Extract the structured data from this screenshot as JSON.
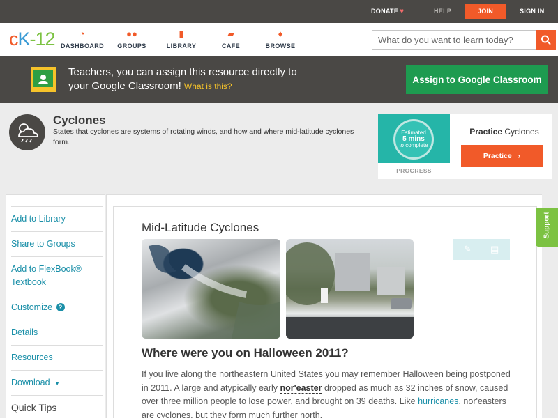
{
  "topbar": {
    "donate": "DONATE",
    "help": "HELP",
    "join": "JOIN",
    "signin": "SIGN IN"
  },
  "nav": {
    "logo": {
      "c": "c",
      "k": "K",
      "dash": "-",
      "n": "12"
    },
    "items": [
      {
        "label": "DASHBOARD",
        "icon": "dashboard-icon"
      },
      {
        "label": "GROUPS",
        "icon": "groups-icon"
      },
      {
        "label": "LIBRARY",
        "icon": "library-icon"
      },
      {
        "label": "CAFE",
        "icon": "cafe-icon"
      },
      {
        "label": "BROWSE",
        "icon": "browse-icon"
      }
    ],
    "search_placeholder": "What do you want to learn today?"
  },
  "banner": {
    "text": "Teachers, you can assign this resource directly to your Google Classroom!",
    "what_link": "What is this?",
    "button": "Assign to Google Classroom"
  },
  "concept": {
    "title": "Cyclones",
    "description": "States that cyclones are systems of rotating winds, and how and where mid-latitude cyclones form."
  },
  "practice": {
    "estimated": "Estimated",
    "mins": "5 mins",
    "to_complete": "to complete",
    "progress_label": "PROGRESS",
    "title_bold": "Practice",
    "title_rest": " Cyclones",
    "button": "Practice"
  },
  "sidebar": {
    "items": [
      "Add to Library",
      "Share to Groups",
      "Add to FlexBook® Textbook",
      "Customize",
      "Details",
      "Resources",
      "Download"
    ],
    "quick_tips": "Quick Tips"
  },
  "content": {
    "section_title": "Mid-Latitude Cyclones",
    "question_title": "Where were you on Halloween 2011?",
    "para_1": "If you live along the northeastern United States you may remember Halloween being postponed in 2011. A large and atypically early ",
    "term": "nor'easter",
    "para_2": " dropped as much as 32 inches of snow, caused over three million people to lose power, and brought on 39 deaths. Like ",
    "link": "hurricanes",
    "para_3": ", nor'easters are cyclones, but they form much further north."
  },
  "support": "Support",
  "colors": {
    "accent": "#f15a29",
    "dark": "#4a4845",
    "google_green": "#1e9b50",
    "teal": "#25b5a8",
    "link": "#1a8fa8",
    "support_green": "#7cc242"
  }
}
